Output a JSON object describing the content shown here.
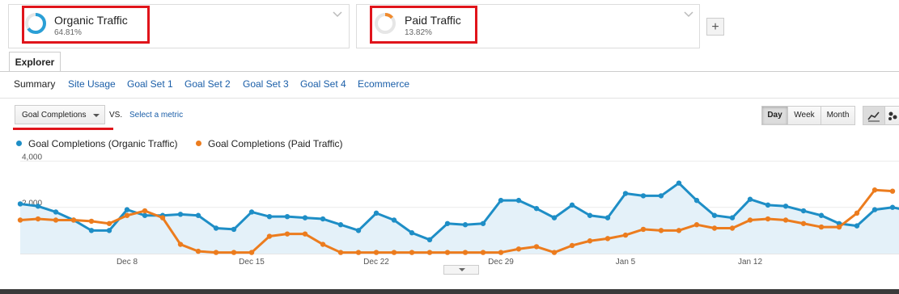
{
  "segments": [
    {
      "name": "Organic Traffic",
      "percent": "64.81%",
      "ring_color": "#2a9fd6",
      "ring_fraction": 0.6481
    },
    {
      "name": "Paid Traffic",
      "percent": "13.82%",
      "ring_color": "#f08a2c",
      "ring_fraction": 0.1382
    }
  ],
  "add_segment_label": "+",
  "explorer_tab": "Explorer",
  "subtabs": [
    "Summary",
    "Site Usage",
    "Goal Set 1",
    "Goal Set 2",
    "Goal Set 3",
    "Goal Set 4",
    "Ecommerce"
  ],
  "active_subtab": "Summary",
  "metric": {
    "selected": "Goal Completions",
    "vs_label": "VS.",
    "select_metric_label": "Select a metric"
  },
  "period_buttons": [
    "Day",
    "Week",
    "Month"
  ],
  "active_period": "Day",
  "highlight_color": "#e0141b",
  "chart_data": {
    "type": "line",
    "ylim": [
      0,
      4400
    ],
    "y_ticks": [
      {
        "label": "4,000",
        "value": 4000
      },
      {
        "label": "2,000",
        "value": 2000
      }
    ],
    "x_tick_labels": [
      {
        "label": "Dec 8",
        "index": 6
      },
      {
        "label": "Dec 15",
        "index": 13
      },
      {
        "label": "Dec 22",
        "index": 20
      },
      {
        "label": "Dec 29",
        "index": 27
      },
      {
        "label": "Jan 5",
        "index": 34
      },
      {
        "label": "Jan 12",
        "index": 41
      }
    ],
    "series": [
      {
        "name": "Goal Completions (Organic Traffic)",
        "color": "#1e8ec6",
        "fill": "#e4f1f9",
        "values": [
          2150,
          2050,
          1800,
          1450,
          1000,
          1000,
          1900,
          1650,
          1650,
          1700,
          1650,
          1100,
          1050,
          1800,
          1600,
          1600,
          1550,
          1500,
          1250,
          1000,
          1750,
          1450,
          900,
          600,
          1300,
          1250,
          1300,
          2300,
          2300,
          1950,
          1550,
          2100,
          1650,
          1550,
          2600,
          2500,
          2500,
          3050,
          2300,
          1650,
          1550,
          2350,
          2100,
          2050,
          1850,
          1650,
          1300,
          1200,
          1900,
          2000,
          1850
        ]
      },
      {
        "name": "Goal Completions (Paid Traffic)",
        "color": "#ec7c1e",
        "fill": "none",
        "values": [
          1450,
          1500,
          1450,
          1450,
          1400,
          1300,
          1650,
          1850,
          1550,
          400,
          100,
          50,
          50,
          50,
          750,
          850,
          850,
          400,
          50,
          50,
          50,
          50,
          50,
          50,
          50,
          50,
          50,
          50,
          200,
          300,
          50,
          350,
          550,
          650,
          800,
          1050,
          1000,
          1000,
          1250,
          1100,
          1100,
          1450,
          1500,
          1450,
          1300,
          1150,
          1150,
          1750,
          2750,
          2700
        ]
      }
    ]
  }
}
